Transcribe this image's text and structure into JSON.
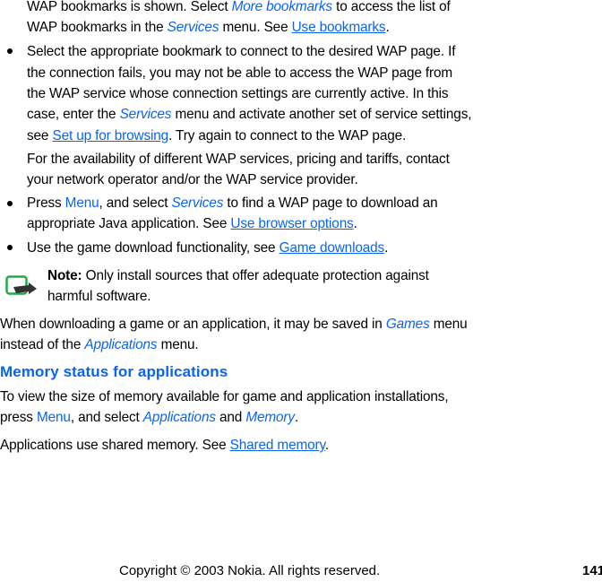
{
  "content": {
    "para1": {
      "line1": {
        "t1": "WAP bookmarks is shown. Select ",
        "more_bookmarks": "More bookmarks",
        "t2": " to access the list of"
      },
      "line2": {
        "t1": "WAP bookmarks in the ",
        "services": "Services",
        "t2": " menu. See ",
        "link_use_bookmarks": "Use bookmarks",
        "t3": "."
      }
    },
    "bullet1": {
      "line1": "Select the appropriate bookmark to connect to the desired WAP page. If",
      "line2": "the connection fails, you may not be able to access the WAP page from",
      "line3": "the WAP service whose connection settings are currently active. In this",
      "line4": {
        "t1": "case, enter the ",
        "services": "Services",
        "t2": " menu and activate another set of service settings,"
      },
      "line5": {
        "t1": "see ",
        "link_setup_browsing": "Set up for browsing",
        "t2": ". Try again to connect to the WAP page."
      },
      "sub_line1": "For the availability of different WAP services, pricing and tariffs, contact",
      "sub_line2": "your network operator and/or the WAP service provider."
    },
    "bullet2": {
      "line1": {
        "t1": "Press ",
        "menu": "Menu",
        "t2": ", and select ",
        "services": "Services",
        "t3": " to find a WAP page to download an"
      },
      "line2": {
        "t1": "appropriate Java application. See ",
        "link_browser_options": "Use browser options",
        "t2": "."
      }
    },
    "bullet3": {
      "t1": "Use the game download functionality, see ",
      "link_game_downloads": "Game downloads",
      "t2": "."
    },
    "note": {
      "icon": "note-icon",
      "label": "Note:",
      "line1": " Only install sources that offer adequate protection against",
      "line2": "harmful software."
    },
    "para2": {
      "line1": {
        "t1": "When downloading a game or an application, it may be saved in ",
        "games": "Games",
        "t2": " menu"
      },
      "line2": {
        "t1": "instead of the ",
        "applications": "Applications",
        "t2": " menu."
      }
    },
    "section": {
      "heading": "Memory status for applications",
      "line1": "To view the size of memory available for game and application installations,",
      "line2": {
        "t1": "press ",
        "menu": "Menu",
        "t2": ", and select ",
        "applications": "Applications",
        "t3": " and ",
        "memory": "Memory",
        "t4": "."
      },
      "line3": {
        "t1": "Applications use shared memory. See ",
        "link_shared_memory": "Shared memory",
        "t2": "."
      }
    }
  },
  "footer": {
    "copyright": "Copyright © 2003 Nokia. All rights reserved.",
    "page_number": "141"
  },
  "colors": {
    "accent": "#0a64f0",
    "note_icon_border": "#22aa44",
    "text": "#000000"
  }
}
